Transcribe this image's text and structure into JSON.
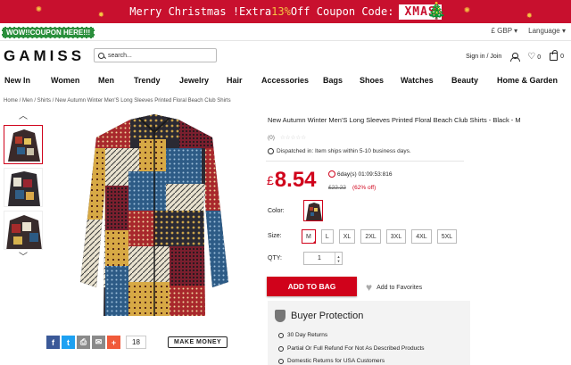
{
  "promo": {
    "prefix": "Merry Christmas !Extra ",
    "percent": "13%",
    "mid": " Off Coupon Code:",
    "code": "XMAS"
  },
  "util": {
    "coupon": "WOW!!COUPON HERE!!!",
    "currency": "£ GBP",
    "language": "Language"
  },
  "header": {
    "logo": "GAMISS",
    "search_placeholder": "search...",
    "signin": "Sign in / Join",
    "wish_count": "0",
    "bag_count": "0"
  },
  "nav": [
    "New In",
    "Women",
    "Men",
    "Trendy",
    "Jewelry",
    "Hair",
    "Accessories",
    "Bags",
    "Shoes",
    "Watches",
    "Beauty",
    "Home & Garden"
  ],
  "breadcrumb": "Home / Men / Shirts / New Autumn Winter Men'S Long Sleeves Printed Floral Beach Club Shirts",
  "product": {
    "title": "New Autumn Winter Men'S Long Sleeves Printed Floral Beach Club Shirts - Black - M",
    "reviews": "(0)",
    "dispatch": "Dispatched in: Item ships within 5-10 business days.",
    "currency": "£",
    "price": "8.54",
    "timer": "6day(s) 01:09:53:816",
    "old_price": "£22.22",
    "discount": "(62% off)",
    "color_label": "Color:",
    "size_label": "Size:",
    "sizes": [
      "M",
      "L",
      "XL",
      "2XL",
      "3XL",
      "4XL",
      "5XL"
    ],
    "selected_size": "M",
    "qty_label": "QTY:",
    "qty": "1",
    "add_to_bag": "ADD TO BAG",
    "add_fav": "Add to Favorites"
  },
  "share": {
    "count": "18",
    "make_money": "MAKE MONEY"
  },
  "buyer": {
    "title": "Buyer Protection",
    "items": [
      "30 Day Returns",
      "Partial Or Full Refund For Not As Described Products",
      "Domestic Returns for USA Customers"
    ]
  },
  "colors": {
    "accent": "#d0021b",
    "promo_bg": "#c8102e",
    "fb": "#3b5998",
    "tw": "#1da1f2"
  }
}
